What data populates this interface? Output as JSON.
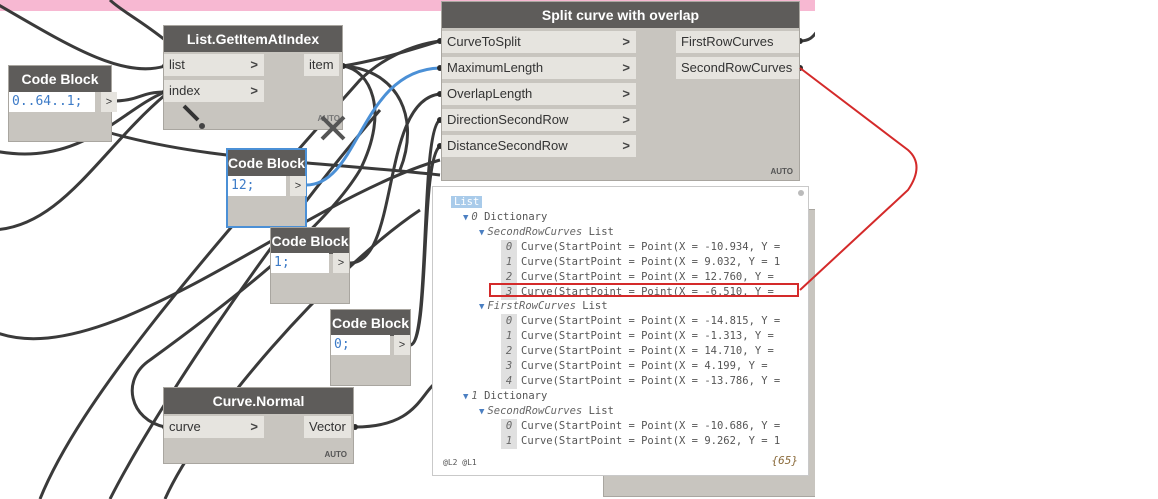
{
  "nodes": {
    "getitem": {
      "title": "List.GetItemAtIndex",
      "inputs": [
        "list",
        "index"
      ],
      "output": "item",
      "auto": "AUTO"
    },
    "split": {
      "title": "Split curve with overlap",
      "inputs": [
        "CurveToSplit",
        "MaximumLength",
        "OverlapLength",
        "DirectionSecondRow",
        "DistanceSecondRow"
      ],
      "outputs": [
        "FirstRowCurves",
        "SecondRowCurves"
      ],
      "auto": "AUTO"
    },
    "normal": {
      "title": "Curve.Normal",
      "input": "curve",
      "output": "Vector",
      "auto": "AUTO"
    },
    "cb1": {
      "title": "Code Block",
      "code": "0..64..1;",
      "out": ">"
    },
    "cb2": {
      "title": "Code Block",
      "code": "12;",
      "out": ">"
    },
    "cb3": {
      "title": "Code Block",
      "code": "1;",
      "out": ">"
    },
    "cb4": {
      "title": "Code Block",
      "code": "0;",
      "out": ">"
    }
  },
  "preview": {
    "root": "List",
    "rows": [
      {
        "kind": "group",
        "idx": "0",
        "label": "Dictionary"
      },
      {
        "kind": "key",
        "key": "SecondRowCurves",
        "label": "List"
      },
      {
        "kind": "item",
        "idx": "0",
        "text": "Curve(StartPoint = Point(X = -10.934, Y ="
      },
      {
        "kind": "item",
        "idx": "1",
        "text": "Curve(StartPoint = Point(X = 9.032, Y = 1"
      },
      {
        "kind": "item",
        "idx": "2",
        "text": "Curve(StartPoint = Point(X = 12.760, Y ="
      },
      {
        "kind": "item",
        "idx": "3",
        "text": "Curve(StartPoint = Point(X = -6.510, Y ="
      },
      {
        "kind": "key",
        "key": "FirstRowCurves",
        "label": "List"
      },
      {
        "kind": "item",
        "idx": "0",
        "text": "Curve(StartPoint = Point(X = -14.815, Y ="
      },
      {
        "kind": "item",
        "idx": "1",
        "text": "Curve(StartPoint = Point(X = -1.313, Y ="
      },
      {
        "kind": "item",
        "idx": "2",
        "text": "Curve(StartPoint = Point(X = 14.710, Y ="
      },
      {
        "kind": "item",
        "idx": "3",
        "text": "Curve(StartPoint = Point(X = 4.199, Y ="
      },
      {
        "kind": "item",
        "idx": "4",
        "text": "Curve(StartPoint = Point(X = -13.786, Y ="
      },
      {
        "kind": "group",
        "idx": "1",
        "label": "Dictionary"
      },
      {
        "kind": "key",
        "key": "SecondRowCurves",
        "label": "List"
      },
      {
        "kind": "item",
        "idx": "0",
        "text": "Curve(StartPoint = Point(X = -10.686, Y ="
      },
      {
        "kind": "item",
        "idx": "1",
        "text": "Curve(StartPoint = Point(X = 9.262, Y = 1"
      }
    ],
    "footer_levels": "@L2 @L1",
    "count": "{65}"
  },
  "colors": {
    "annotation": "#d42a2a",
    "wire": "#3a3a3a",
    "selected_wire": "#4b90d6",
    "pink": "#f7b8d2"
  }
}
